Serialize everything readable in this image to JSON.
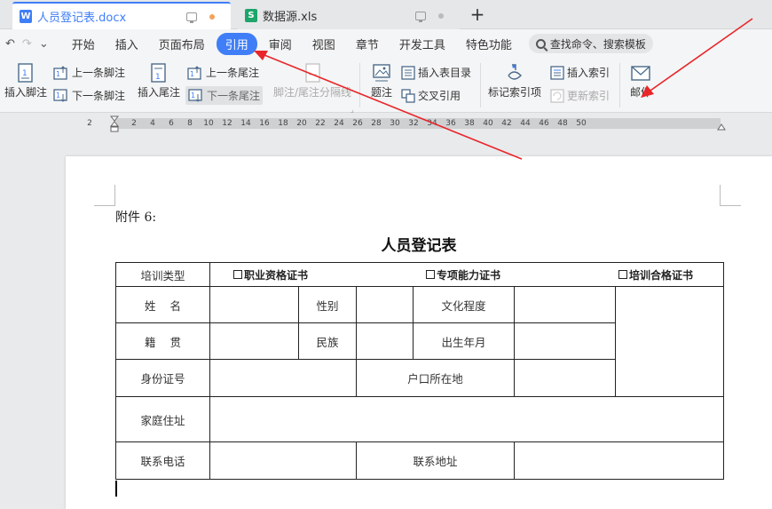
{
  "tabs": [
    {
      "title": "人员登记表.docx",
      "icon": "W",
      "active": true
    },
    {
      "title": "数据源.xls",
      "icon": "S",
      "active": false
    }
  ],
  "new_tab": "+",
  "quick_access": {
    "undo": "↶",
    "redo": "↷",
    "more": "⌄"
  },
  "menu": [
    "开始",
    "插入",
    "页面布局",
    "引用",
    "审阅",
    "视图",
    "章节",
    "开发工具",
    "特色功能"
  ],
  "menu_active": "引用",
  "search": {
    "placeholder": "查找命令、搜索模板"
  },
  "ribbon": {
    "insert_footnote": "插入脚注",
    "prev_footnote": "上一条脚注",
    "next_footnote": "下一条脚注",
    "insert_endnote": "插入尾注",
    "prev_endnote": "上一条尾注",
    "next_endnote": "下一条尾注",
    "separator_line": "脚注/尾注分隔线",
    "caption": "题注",
    "insert_toc_table": "插入表目录",
    "cross_ref": "交叉引用",
    "mark_index": "标记索引项",
    "insert_index": "插入索引",
    "update_index": "更新索引",
    "mail": "邮件"
  },
  "ruler": [
    "2",
    "2",
    "4",
    "6",
    "8",
    "10",
    "12",
    "14",
    "16",
    "18",
    "20",
    "22",
    "24",
    "26",
    "28",
    "30",
    "32",
    "34",
    "36",
    "38",
    "40",
    "42",
    "44",
    "46",
    "48",
    "50"
  ],
  "document": {
    "attachment": "附件 6:",
    "title": "人员登记表",
    "row1": {
      "label": "培训类型",
      "c1": "职业资格证书",
      "c2": "专项能力证书",
      "c3": "培训合格证书"
    },
    "row2": {
      "name": "姓    名",
      "gender": "性别",
      "edu": "文化程度"
    },
    "row3": {
      "origin": "籍    贯",
      "ethnic": "民族",
      "birth": "出生年月"
    },
    "row4": {
      "id": "身份证号",
      "hukou": "户口所在地"
    },
    "row5": {
      "home": "家庭住址"
    },
    "row6": {
      "phone": "联系电话",
      "address": "联系地址"
    }
  }
}
